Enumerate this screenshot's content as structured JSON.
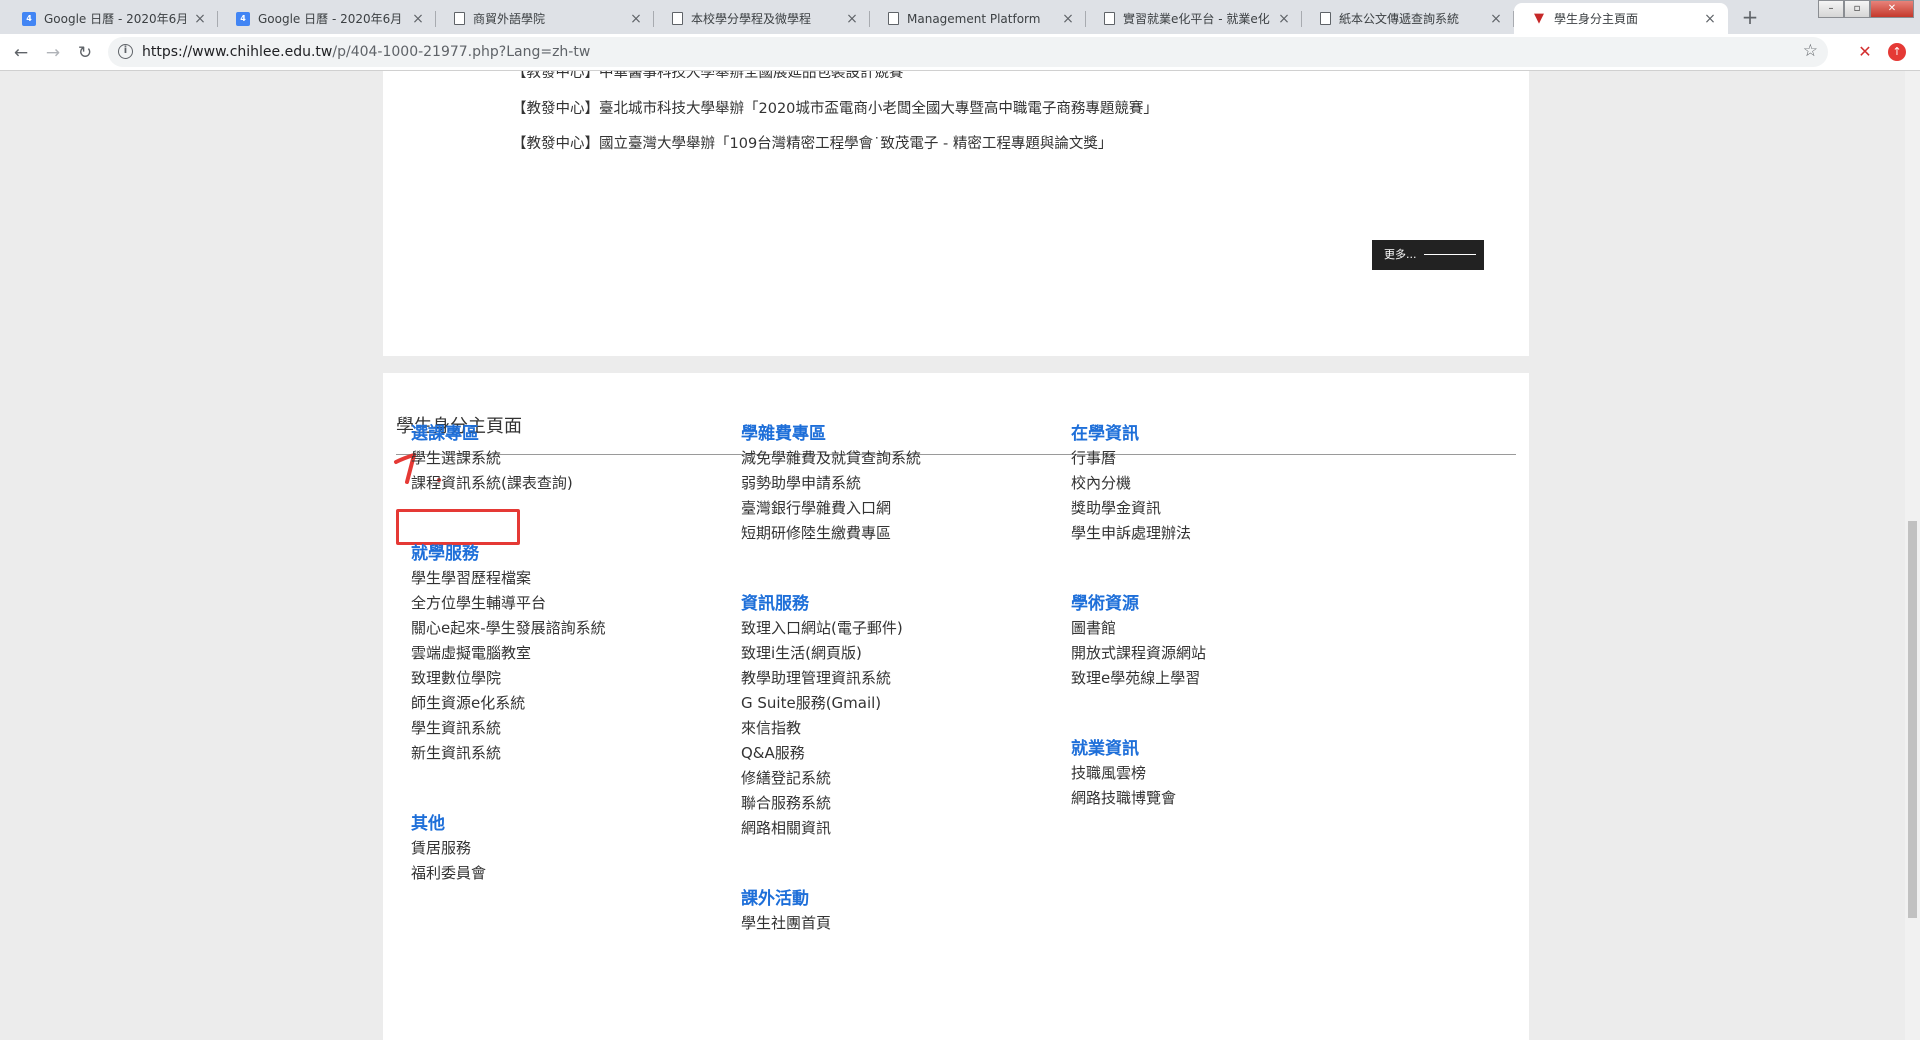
{
  "browser": {
    "tabs": [
      {
        "title": "Google 日曆 - 2020年6月",
        "icon": "google-calendar-icon",
        "active": false
      },
      {
        "title": "Google 日曆 - 2020年6月",
        "icon": "google-calendar-icon",
        "active": false
      },
      {
        "title": "商貿外語學院",
        "icon": "document-icon",
        "active": false
      },
      {
        "title": "本校學分學程及微學程",
        "icon": "document-icon",
        "active": false
      },
      {
        "title": "Management Platform",
        "icon": "document-icon",
        "active": false
      },
      {
        "title": "實習就業e化平台 - 就業e化",
        "icon": "document-icon",
        "active": false
      },
      {
        "title": "紙本公文傳遞查詢系統",
        "icon": "document-icon",
        "active": false
      },
      {
        "title": "學生身分主頁面",
        "icon": "chihlee-logo-icon",
        "active": true
      }
    ],
    "calendar_icon_text": "4",
    "new_tab_symbol": "+",
    "url_main": "https://www.chihlee.edu.tw",
    "url_rest": "/p/404-1000-21977.php?Lang=zh-tw"
  },
  "page": {
    "news_items": [
      "【教發中心】中華醫事科技大學舉辦全國展延品包裝設計競賽",
      "【教發中心】臺北城市科技大學舉辦「2020城市盃電商小老闆全國大專暨高中職電子商務專題競賽」",
      "【教發中心】國立臺灣大學舉辦「109台灣精密工程學會˙致茂電子 - 精密工程專題與論文獎」"
    ],
    "more_label": "更多...",
    "section_title": "學生身分主頁面",
    "annotation_label": "1.",
    "categories": {
      "course": {
        "title": "選課專區",
        "links": [
          "學生選課系統",
          "課程資訊系統(課表查詢)"
        ]
      },
      "tuition": {
        "title": "學雜費專區",
        "links": [
          "減免學雜費及就貸查詢系統",
          "弱勢助學申請系統",
          "臺灣銀行學雜費入口網",
          "短期研修陸生繳費專區"
        ]
      },
      "school_info": {
        "title": "在學資訊",
        "links": [
          "行事曆",
          "校內分機",
          "獎助學金資訊",
          "學生申訴處理辦法"
        ]
      },
      "study": {
        "title": "就學服務",
        "links": [
          "學生學習歷程檔案",
          "全方位學生輔導平台",
          "關心e起來-學生發展諮詢系統",
          "雲端虛擬電腦教室",
          "致理數位學院",
          "師生資源e化系統",
          "學生資訊系統",
          "新生資訊系統"
        ]
      },
      "it": {
        "title": "資訊服務",
        "links": [
          "致理入口網站(電子郵件)",
          "致理i生活(網頁版)",
          "教學助理管理資訊系統",
          "G Suite服務(Gmail)",
          "來信指教",
          "Q&A服務",
          "修繕登記系統",
          "聯合服務系統",
          "網路相關資訊"
        ]
      },
      "academic": {
        "title": "學術資源",
        "links": [
          "圖書館",
          "開放式課程資源網站",
          "致理e學苑線上學習"
        ]
      },
      "career": {
        "title": "就業資訊",
        "links": [
          "技職風雲榜",
          "網路技職博覽會"
        ]
      },
      "other": {
        "title": "其他",
        "links": [
          "賃居服務",
          "福利委員會"
        ]
      },
      "activities": {
        "title": "課外活動",
        "links": [
          "學生社團首頁"
        ]
      }
    }
  },
  "colors": {
    "category_blue": "#1e6fd9",
    "annotation_red": "#e53935"
  }
}
